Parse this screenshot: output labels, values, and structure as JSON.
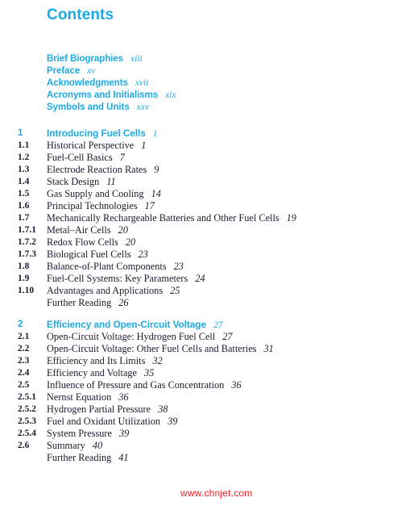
{
  "document": {
    "title": "Contents",
    "accent_color": "#1CAAE4",
    "text_color": "#1B1A2E",
    "background_color": "#FFFFFF"
  },
  "front_matter": [
    {
      "label": "Brief Biographies",
      "page": "xiii"
    },
    {
      "label": "Preface",
      "page": "xv"
    },
    {
      "label": "Acknowledgments",
      "page": "xvii"
    },
    {
      "label": "Acronyms and Initialisms",
      "page": "xix"
    },
    {
      "label": "Symbols and Units",
      "page": "xxv"
    }
  ],
  "chapters": [
    {
      "number": "1",
      "title": "Introducing Fuel Cells",
      "page": "1",
      "entries": [
        {
          "number": "1.1",
          "title": "Historical Perspective",
          "page": "1"
        },
        {
          "number": "1.2",
          "title": "Fuel-Cell Basics",
          "page": "7"
        },
        {
          "number": "1.3",
          "title": "Electrode Reaction Rates",
          "page": "9"
        },
        {
          "number": "1.4",
          "title": "Stack Design",
          "page": "11"
        },
        {
          "number": "1.5",
          "title": "Gas Supply and Cooling",
          "page": "14"
        },
        {
          "number": "1.6",
          "title": "Principal Technologies",
          "page": "17"
        },
        {
          "number": "1.7",
          "title": "Mechanically Rechargeable Batteries and Other Fuel Cells",
          "page": "19"
        },
        {
          "number": "1.7.1",
          "title": "Metal–Air Cells",
          "page": "20"
        },
        {
          "number": "1.7.2",
          "title": "Redox Flow Cells",
          "page": "20"
        },
        {
          "number": "1.7.3",
          "title": "Biological Fuel Cells",
          "page": "23"
        },
        {
          "number": "1.8",
          "title": "Balance-of-Plant Components",
          "page": "23"
        },
        {
          "number": "1.9",
          "title": "Fuel-Cell Systems: Key Parameters",
          "page": "24"
        },
        {
          "number": "1.10",
          "title": "Advantages and Applications",
          "page": "25"
        },
        {
          "number": "",
          "title": "Further Reading",
          "page": "26"
        }
      ]
    },
    {
      "number": "2",
      "title": "Efficiency and Open-Circuit Voltage",
      "page": "27",
      "entries": [
        {
          "number": "2.1",
          "title": "Open-Circuit Voltage: Hydrogen Fuel Cell",
          "page": "27"
        },
        {
          "number": "2.2",
          "title": "Open-Circuit Voltage: Other Fuel Cells and Batteries",
          "page": "31"
        },
        {
          "number": "2.3",
          "title": "Efficiency and Its Limits",
          "page": "32"
        },
        {
          "number": "2.4",
          "title": "Efficiency and Voltage",
          "page": "35"
        },
        {
          "number": "2.5",
          "title": "Influence of Pressure and Gas Concentration",
          "page": "36"
        },
        {
          "number": "2.5.1",
          "title": "Nernst Equation",
          "page": "36"
        },
        {
          "number": "2.5.2",
          "title": "Hydrogen Partial Pressure",
          "page": "38"
        },
        {
          "number": "2.5.3",
          "title": "Fuel and Oxidant Utilization",
          "page": "39"
        },
        {
          "number": "2.5.4",
          "title": "System Pressure",
          "page": "39"
        },
        {
          "number": "2.6",
          "title": "Summary",
          "page": "40"
        },
        {
          "number": "",
          "title": "Further Reading",
          "page": "41"
        }
      ]
    }
  ],
  "watermark": {
    "text": "www.chnjet.com",
    "color": "#FF1A1A"
  }
}
